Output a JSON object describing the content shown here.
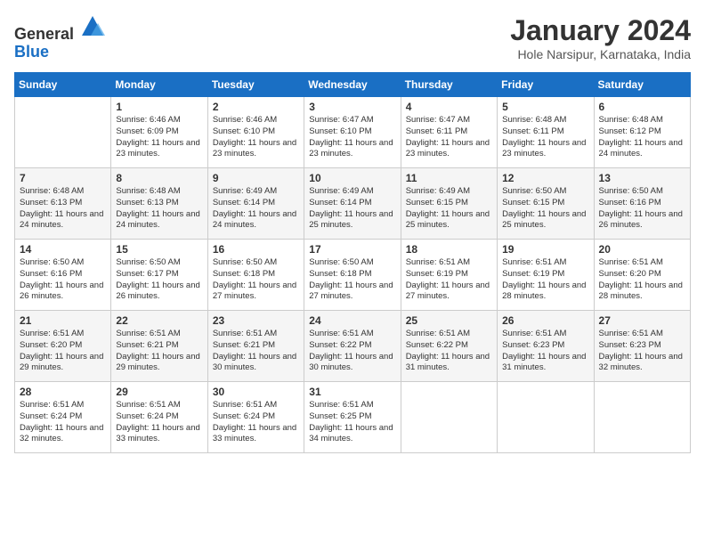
{
  "header": {
    "logo_general": "General",
    "logo_blue": "Blue",
    "title": "January 2024",
    "subtitle": "Hole Narsipur, Karnataka, India"
  },
  "weekdays": [
    "Sunday",
    "Monday",
    "Tuesday",
    "Wednesday",
    "Thursday",
    "Friday",
    "Saturday"
  ],
  "weeks": [
    [
      {
        "day": "",
        "sunrise": "",
        "sunset": "",
        "daylight": ""
      },
      {
        "day": "1",
        "sunrise": "Sunrise: 6:46 AM",
        "sunset": "Sunset: 6:09 PM",
        "daylight": "Daylight: 11 hours and 23 minutes."
      },
      {
        "day": "2",
        "sunrise": "Sunrise: 6:46 AM",
        "sunset": "Sunset: 6:10 PM",
        "daylight": "Daylight: 11 hours and 23 minutes."
      },
      {
        "day": "3",
        "sunrise": "Sunrise: 6:47 AM",
        "sunset": "Sunset: 6:10 PM",
        "daylight": "Daylight: 11 hours and 23 minutes."
      },
      {
        "day": "4",
        "sunrise": "Sunrise: 6:47 AM",
        "sunset": "Sunset: 6:11 PM",
        "daylight": "Daylight: 11 hours and 23 minutes."
      },
      {
        "day": "5",
        "sunrise": "Sunrise: 6:48 AM",
        "sunset": "Sunset: 6:11 PM",
        "daylight": "Daylight: 11 hours and 23 minutes."
      },
      {
        "day": "6",
        "sunrise": "Sunrise: 6:48 AM",
        "sunset": "Sunset: 6:12 PM",
        "daylight": "Daylight: 11 hours and 24 minutes."
      }
    ],
    [
      {
        "day": "7",
        "sunrise": "Sunrise: 6:48 AM",
        "sunset": "Sunset: 6:13 PM",
        "daylight": "Daylight: 11 hours and 24 minutes."
      },
      {
        "day": "8",
        "sunrise": "Sunrise: 6:48 AM",
        "sunset": "Sunset: 6:13 PM",
        "daylight": "Daylight: 11 hours and 24 minutes."
      },
      {
        "day": "9",
        "sunrise": "Sunrise: 6:49 AM",
        "sunset": "Sunset: 6:14 PM",
        "daylight": "Daylight: 11 hours and 24 minutes."
      },
      {
        "day": "10",
        "sunrise": "Sunrise: 6:49 AM",
        "sunset": "Sunset: 6:14 PM",
        "daylight": "Daylight: 11 hours and 25 minutes."
      },
      {
        "day": "11",
        "sunrise": "Sunrise: 6:49 AM",
        "sunset": "Sunset: 6:15 PM",
        "daylight": "Daylight: 11 hours and 25 minutes."
      },
      {
        "day": "12",
        "sunrise": "Sunrise: 6:50 AM",
        "sunset": "Sunset: 6:15 PM",
        "daylight": "Daylight: 11 hours and 25 minutes."
      },
      {
        "day": "13",
        "sunrise": "Sunrise: 6:50 AM",
        "sunset": "Sunset: 6:16 PM",
        "daylight": "Daylight: 11 hours and 26 minutes."
      }
    ],
    [
      {
        "day": "14",
        "sunrise": "Sunrise: 6:50 AM",
        "sunset": "Sunset: 6:16 PM",
        "daylight": "Daylight: 11 hours and 26 minutes."
      },
      {
        "day": "15",
        "sunrise": "Sunrise: 6:50 AM",
        "sunset": "Sunset: 6:17 PM",
        "daylight": "Daylight: 11 hours and 26 minutes."
      },
      {
        "day": "16",
        "sunrise": "Sunrise: 6:50 AM",
        "sunset": "Sunset: 6:18 PM",
        "daylight": "Daylight: 11 hours and 27 minutes."
      },
      {
        "day": "17",
        "sunrise": "Sunrise: 6:50 AM",
        "sunset": "Sunset: 6:18 PM",
        "daylight": "Daylight: 11 hours and 27 minutes."
      },
      {
        "day": "18",
        "sunrise": "Sunrise: 6:51 AM",
        "sunset": "Sunset: 6:19 PM",
        "daylight": "Daylight: 11 hours and 27 minutes."
      },
      {
        "day": "19",
        "sunrise": "Sunrise: 6:51 AM",
        "sunset": "Sunset: 6:19 PM",
        "daylight": "Daylight: 11 hours and 28 minutes."
      },
      {
        "day": "20",
        "sunrise": "Sunrise: 6:51 AM",
        "sunset": "Sunset: 6:20 PM",
        "daylight": "Daylight: 11 hours and 28 minutes."
      }
    ],
    [
      {
        "day": "21",
        "sunrise": "Sunrise: 6:51 AM",
        "sunset": "Sunset: 6:20 PM",
        "daylight": "Daylight: 11 hours and 29 minutes."
      },
      {
        "day": "22",
        "sunrise": "Sunrise: 6:51 AM",
        "sunset": "Sunset: 6:21 PM",
        "daylight": "Daylight: 11 hours and 29 minutes."
      },
      {
        "day": "23",
        "sunrise": "Sunrise: 6:51 AM",
        "sunset": "Sunset: 6:21 PM",
        "daylight": "Daylight: 11 hours and 30 minutes."
      },
      {
        "day": "24",
        "sunrise": "Sunrise: 6:51 AM",
        "sunset": "Sunset: 6:22 PM",
        "daylight": "Daylight: 11 hours and 30 minutes."
      },
      {
        "day": "25",
        "sunrise": "Sunrise: 6:51 AM",
        "sunset": "Sunset: 6:22 PM",
        "daylight": "Daylight: 11 hours and 31 minutes."
      },
      {
        "day": "26",
        "sunrise": "Sunrise: 6:51 AM",
        "sunset": "Sunset: 6:23 PM",
        "daylight": "Daylight: 11 hours and 31 minutes."
      },
      {
        "day": "27",
        "sunrise": "Sunrise: 6:51 AM",
        "sunset": "Sunset: 6:23 PM",
        "daylight": "Daylight: 11 hours and 32 minutes."
      }
    ],
    [
      {
        "day": "28",
        "sunrise": "Sunrise: 6:51 AM",
        "sunset": "Sunset: 6:24 PM",
        "daylight": "Daylight: 11 hours and 32 minutes."
      },
      {
        "day": "29",
        "sunrise": "Sunrise: 6:51 AM",
        "sunset": "Sunset: 6:24 PM",
        "daylight": "Daylight: 11 hours and 33 minutes."
      },
      {
        "day": "30",
        "sunrise": "Sunrise: 6:51 AM",
        "sunset": "Sunset: 6:24 PM",
        "daylight": "Daylight: 11 hours and 33 minutes."
      },
      {
        "day": "31",
        "sunrise": "Sunrise: 6:51 AM",
        "sunset": "Sunset: 6:25 PM",
        "daylight": "Daylight: 11 hours and 34 minutes."
      },
      {
        "day": "",
        "sunrise": "",
        "sunset": "",
        "daylight": ""
      },
      {
        "day": "",
        "sunrise": "",
        "sunset": "",
        "daylight": ""
      },
      {
        "day": "",
        "sunrise": "",
        "sunset": "",
        "daylight": ""
      }
    ]
  ]
}
